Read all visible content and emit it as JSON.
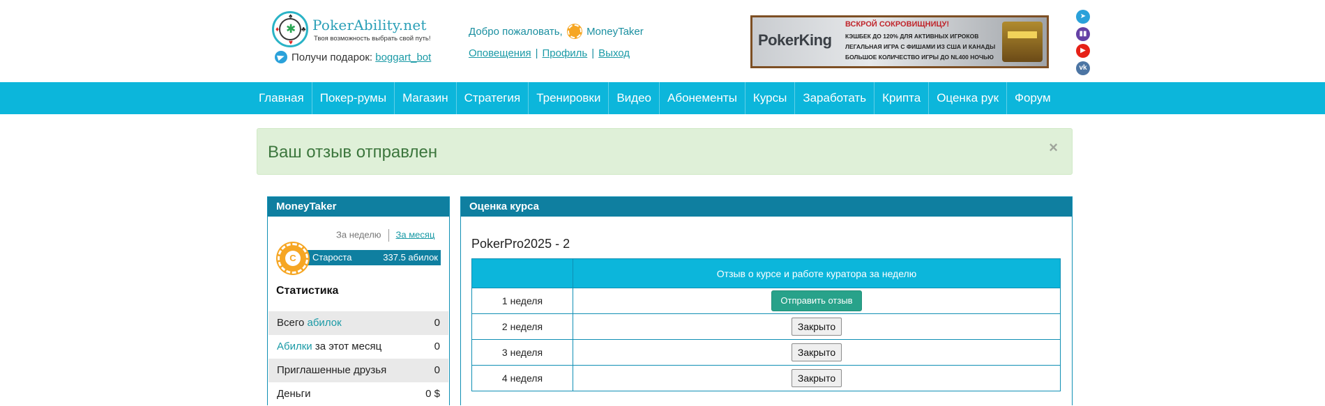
{
  "header": {
    "logo": {
      "title": "PokerAbility.net",
      "tagline": "Твоя возможность выбрать свой путь!"
    },
    "gift_text": "Получи подарок:",
    "gift_link": "boggart_bot",
    "welcome_text": "Добро пожаловать,",
    "username": "MoneyTaker",
    "user_links": [
      "Оповещения",
      "Профиль",
      "Выход"
    ],
    "banner": {
      "brand": "PokerKing",
      "title": "ВСКРОЙ СОКРОВИЩНИЦУ!",
      "lines": [
        "КЭШБЕК ДО 120% ДЛЯ АКТИВНЫХ ИГРОКОВ",
        "ЛЕГАЛЬНАЯ ИГРА С ФИШАМИ ИЗ США И КАНАДЫ",
        "БОЛЬШОЕ КОЛИЧЕСТВО ИГРЫ ДО NL400 НОЧЬЮ"
      ]
    },
    "social_icons": [
      "telegram-icon",
      "twitch-icon",
      "youtube-icon",
      "vk-icon"
    ]
  },
  "nav": {
    "items": [
      "Главная",
      "Покер-румы",
      "Магазин",
      "Стратегия",
      "Тренировки",
      "Видео",
      "Абонементы",
      "Курсы",
      "Заработать",
      "Крипта",
      "Оценка рук",
      "Форум"
    ]
  },
  "alert": {
    "message": "Ваш отзыв отправлен",
    "close": "×"
  },
  "sidebar": {
    "title": "MoneyTaker",
    "period_week": "За неделю",
    "period_month": "За месяц",
    "rank": {
      "chip_letter": "С",
      "name": "Староста",
      "value": "337.5 абилок"
    },
    "stats_title": "Статистика",
    "stats": [
      {
        "label_pre": "Всего ",
        "label_hl": "абилок",
        "label_post": "",
        "value": "0"
      },
      {
        "label_pre": "",
        "label_hl": "Абилки",
        "label_post": " за этот месяц",
        "value": "0"
      },
      {
        "label_pre": "Приглашенные друзья",
        "label_hl": "",
        "label_post": "",
        "value": "0"
      },
      {
        "label_pre": "Деньги",
        "label_hl": "",
        "label_post": "",
        "value": "0 $"
      }
    ]
  },
  "main": {
    "title": "Оценка курса",
    "course": "PokerPro2025 - 2",
    "table_header": "Отзыв о курсе и работе куратора за неделю",
    "rows": [
      {
        "week": "1 неделя",
        "action": "Отправить отзыв",
        "active": true
      },
      {
        "week": "2 неделя",
        "action": "Закрыто",
        "active": false
      },
      {
        "week": "3 неделя",
        "action": "Закрыто",
        "active": false
      },
      {
        "week": "4 неделя",
        "action": "Закрыто",
        "active": false
      }
    ]
  },
  "colors": {
    "nav": "#0cb6db",
    "panel_head": "#0f7fa0",
    "alert_bg": "#dff0d8",
    "alert_text": "#3c763d",
    "accent": "#1a9aa6",
    "send_button": "#28a28a"
  }
}
